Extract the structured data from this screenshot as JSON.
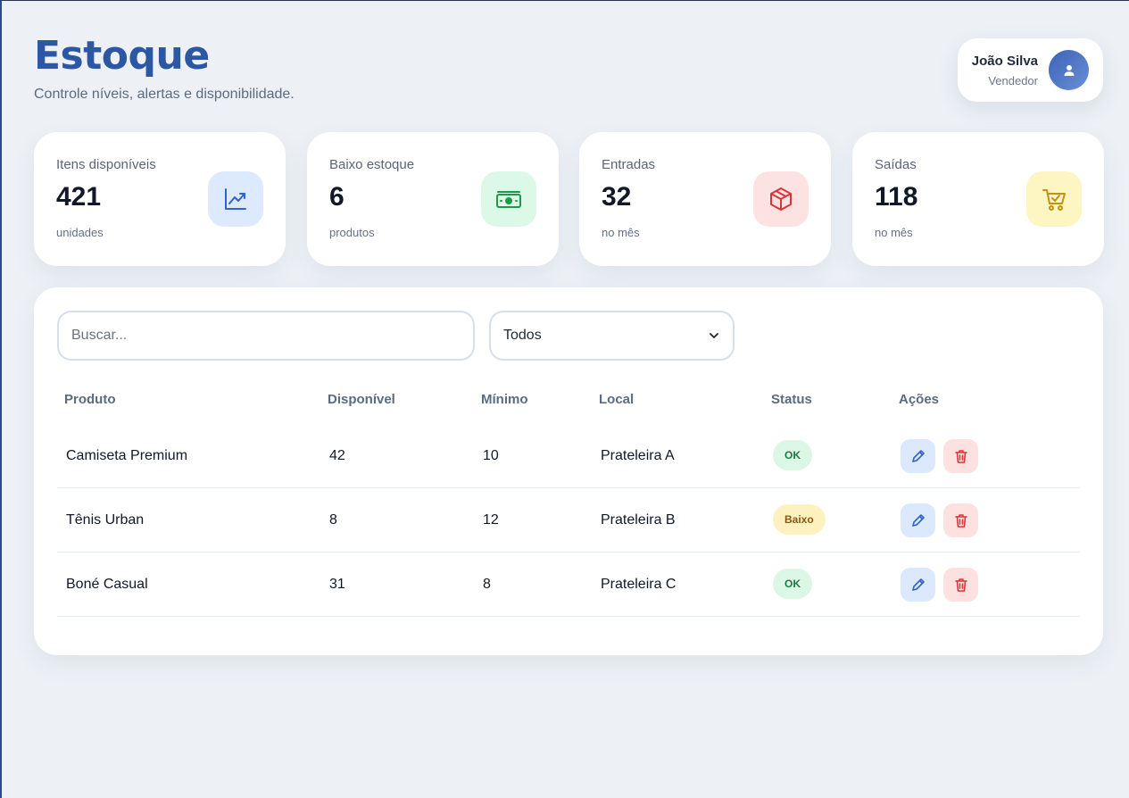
{
  "header": {
    "title": "Estoque",
    "subtitle": "Controle níveis, alertas e disponibilidade."
  },
  "user": {
    "name": "João Silva",
    "role": "Vendedor",
    "icon": "user-icon"
  },
  "stats": [
    {
      "label": "Itens disponíveis",
      "value": "421",
      "unit": "unidades",
      "icon": "trending-up-icon",
      "bg": "#dde9fc",
      "color": "#2f63d0"
    },
    {
      "label": "Baixo estoque",
      "value": "6",
      "unit": "produtos",
      "icon": "money-icon",
      "bg": "#dcf8e6",
      "color": "#1c9a4a"
    },
    {
      "label": "Entradas",
      "value": "32",
      "unit": "no mês",
      "icon": "package-icon",
      "bg": "#fde2e2",
      "color": "#d9363a"
    },
    {
      "label": "Saídas",
      "value": "118",
      "unit": "no mês",
      "icon": "cart-icon",
      "bg": "#fdf5c2",
      "color": "#c4920e"
    }
  ],
  "filters": {
    "search_placeholder": "Buscar...",
    "search_value": "",
    "select_value": "Todos"
  },
  "table": {
    "columns": [
      "Produto",
      "Disponível",
      "Mínimo",
      "Local",
      "Status",
      "Ações"
    ],
    "rows": [
      {
        "produto": "Camiseta Premium",
        "disponivel": "42",
        "minimo": "10",
        "local": "Prateleira A",
        "status": "OK",
        "status_type": "ok"
      },
      {
        "produto": "Tênis Urban",
        "disponivel": "8",
        "minimo": "12",
        "local": "Prateleira B",
        "status": "Baixo",
        "status_type": "low"
      },
      {
        "produto": "Boné Casual",
        "disponivel": "31",
        "minimo": "8",
        "local": "Prateleira C",
        "status": "OK",
        "status_type": "ok"
      }
    ]
  },
  "colors": {
    "accent": "#2c57a3",
    "edit": "#2f63d0",
    "delete": "#d9363a"
  }
}
